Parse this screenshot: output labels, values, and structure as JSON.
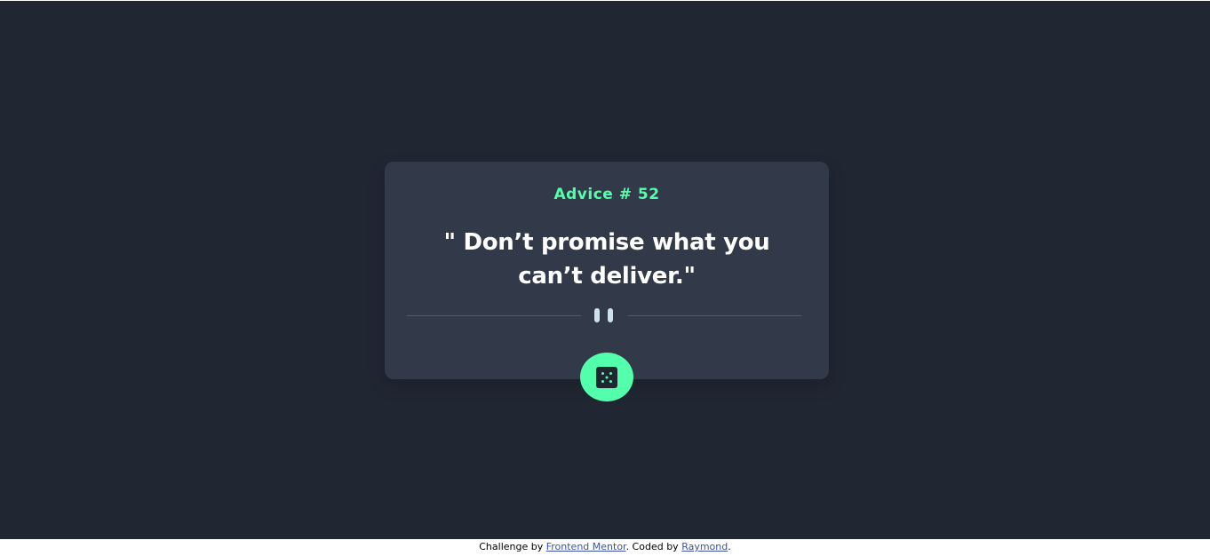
{
  "advice": {
    "heading": "Advice # 52",
    "quote": "\" Don’t promise what you can’t deliver.\""
  },
  "divider": {
    "icon": "pause-icon"
  },
  "dice_button": {
    "icon": "dice-icon",
    "color": "#53ffaa"
  },
  "footer": {
    "challenge_prefix": "Challenge by ",
    "challenge_link": "Frontend Mentor",
    "coded_by_prefix": ". Coded by ",
    "author_link": "Raymond",
    "suffix": "."
  },
  "colors": {
    "background": "#202632",
    "card": "#323a49",
    "accent": "#53ffaa",
    "divider": "#4f5d74",
    "link": "#3e52a3"
  }
}
